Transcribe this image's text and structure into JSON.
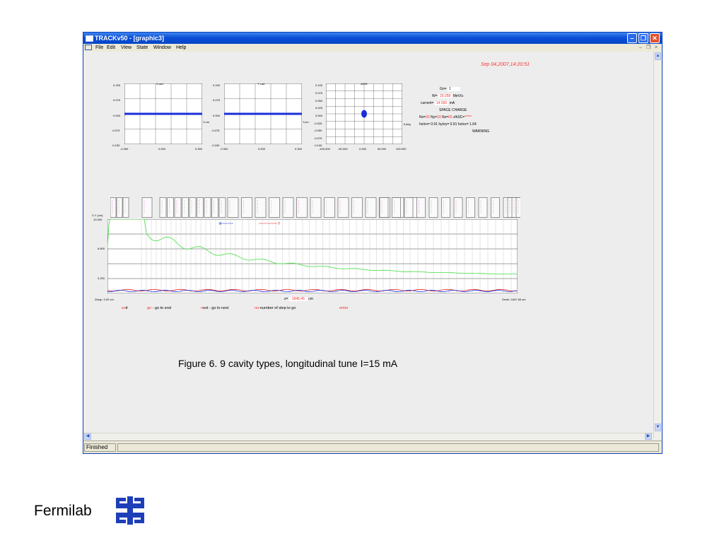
{
  "window": {
    "title": "TRACKv50 - [graphic3]",
    "menu": [
      "File",
      "Edit",
      "View",
      "State",
      "Window",
      "Help"
    ],
    "status": "Finished"
  },
  "datetime": "Sep 04,2007,14:20:51",
  "plots": [
    {
      "label": "X,rad",
      "axis_label": "X,cm",
      "yticks": [
        "0.150",
        "0.075",
        "0.000",
        "-0.075",
        "-0.150"
      ],
      "xticks": [
        "-0.300",
        "0.000",
        "0.300"
      ]
    },
    {
      "label": "Y',rad",
      "axis_label": "Y,cm",
      "yticks": [
        "0.150",
        "0.075",
        "0.000",
        "-0.075",
        "-0.150"
      ],
      "xticks": [
        "-0.300",
        "0.000",
        "0.300"
      ]
    },
    {
      "label": "dW/E",
      "axis_label": "fi,deg",
      "yticks": [
        "0.100",
        "0.075",
        "0.050",
        "0.025",
        "0.000",
        "-0.025",
        "-0.050",
        "-0.075",
        "-0.100"
      ],
      "xticks": [
        "-100.000",
        "-50.000",
        "0.000",
        "50.000",
        "100.000"
      ]
    }
  ],
  "info": {
    "gn_label": "Gn=",
    "gn": "1",
    "w_label": "W=",
    "w": "20.258",
    "w_unit": "MeV/u",
    "current_label": "current=",
    "current": "14.565",
    "current_unit": "mA",
    "space_charge": "SPACE CHARGE",
    "nx_label": "Nx=",
    "nx": "33",
    "ny_label": "Ny=",
    "ny": "33",
    "nz_label": "Nz=",
    "nz": "65",
    "zl_label": "zlhSC=",
    "zl": "*****",
    "line2": "hx/ex= 0.91  hy/ey= 0.91  hz/ez= 1.64",
    "warning": "WARNING"
  },
  "envelope": {
    "ylabel": "X,Y (cm)",
    "yticks": [
      "10.000",
      "6.600",
      "3.200"
    ],
    "legend_x": "X",
    "legend_y": "Y",
    "zbeg": "Zbeg=   0.00 cm",
    "z_label": "z=",
    "z_value": "1846.45",
    "z_unit": "cm",
    "zend": "Zend=  1847.65 cm"
  },
  "commands": [
    {
      "hot": "ex",
      "rest": "it"
    },
    {
      "hot": "go",
      "rest": " - go to end"
    },
    {
      "hot": "n",
      "rest": "ext - go to next"
    },
    {
      "hot": "nn",
      "rest": "-number of step to go"
    },
    {
      "hot": "enter",
      "rest": ""
    }
  ],
  "caption": "Figure 6. 9 cavity types, longitudinal tune I=15 mA",
  "logo_text": "Fermilab",
  "colors": {
    "title": "#0a4fd6",
    "beam": "#1a2fd8",
    "green": "#44dd44",
    "red": "#e02020"
  }
}
